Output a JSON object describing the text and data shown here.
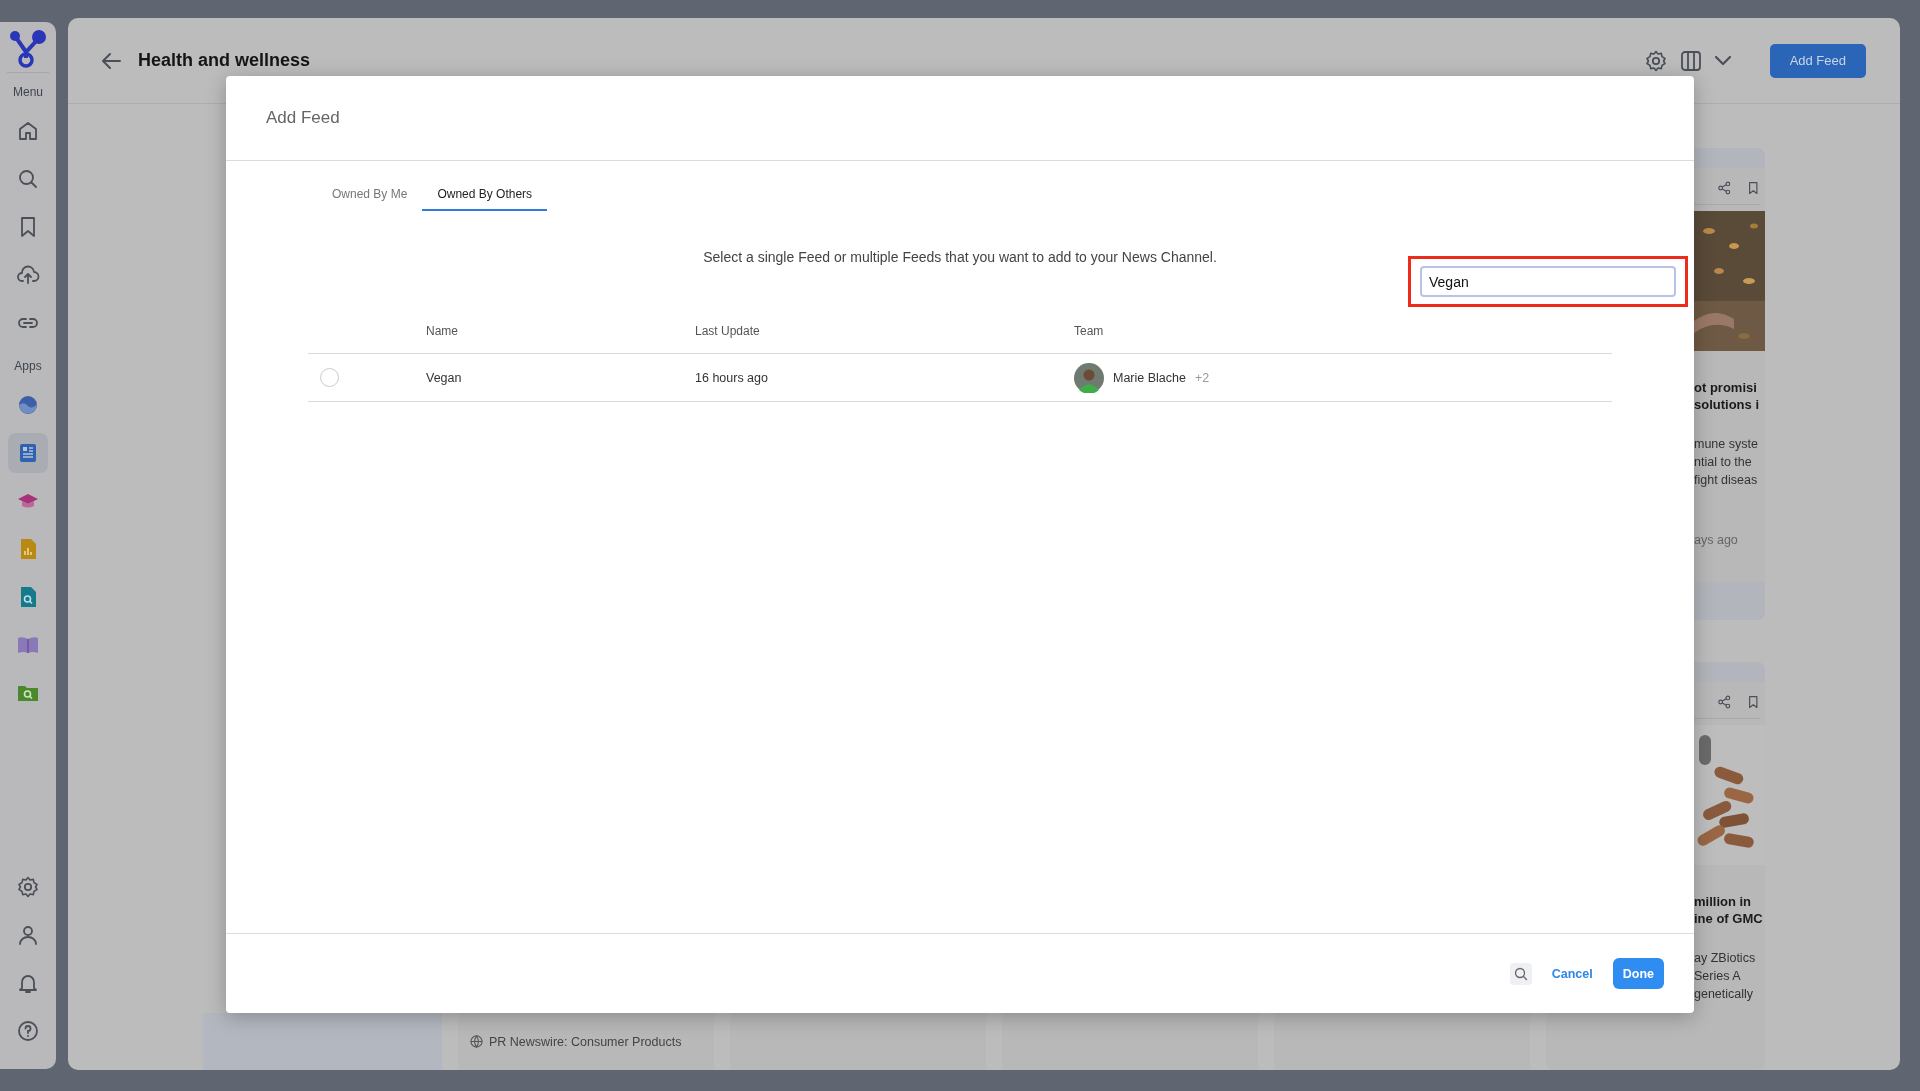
{
  "sidebar": {
    "menu_label": "Menu",
    "menu_items": [
      {
        "kind": "home"
      },
      {
        "kind": "search"
      },
      {
        "kind": "bookmark"
      },
      {
        "kind": "upload"
      },
      {
        "kind": "link"
      }
    ],
    "apps_label": "Apps",
    "apps": [
      {
        "kind": "wave",
        "selected": false
      },
      {
        "kind": "news",
        "selected": true
      },
      {
        "kind": "cap",
        "selected": false
      },
      {
        "kind": "chart",
        "selected": false
      },
      {
        "kind": "docsearch",
        "selected": false
      },
      {
        "kind": "book",
        "selected": false
      },
      {
        "kind": "folder",
        "selected": false
      }
    ],
    "bottom_items": [
      {
        "kind": "settings"
      },
      {
        "kind": "user"
      },
      {
        "kind": "bell"
      },
      {
        "kind": "help"
      }
    ]
  },
  "header": {
    "title": "Health and wellness",
    "add_button": "Add Feed"
  },
  "background_cards": [
    {
      "kind": "leaves",
      "headline": [
        "ot promisi",
        "solutions i"
      ],
      "body": [
        "mune syste",
        "ntial to the",
        "fight diseas"
      ],
      "time": "ays ago"
    },
    {
      "kind": "pills",
      "headline": [
        "million in",
        "ine of GMC"
      ],
      "body": [
        "ay ZBiotics",
        "Series A",
        "genetically"
      ]
    }
  ],
  "bottom_source": "PR Newswire: Consumer Products",
  "dialog": {
    "title": "Add Feed",
    "tabs": [
      {
        "label": "Owned By Me",
        "selected": false
      },
      {
        "label": "Owned By Others",
        "selected": true
      }
    ],
    "instruction": "Select a single Feed or multiple Feeds that you want to add to your News Channel.",
    "search": {
      "value": "Vegan",
      "highlighted": true
    },
    "table": {
      "columns": [
        "Name",
        "Last Update",
        "Team"
      ],
      "rows": [
        {
          "selected": false,
          "name": "Vegan",
          "last_update": "16 hours ago",
          "team_lead": "Marie Blache",
          "team_extra": "+2"
        }
      ]
    },
    "footer": {
      "cancel": "Cancel",
      "done": "Done"
    }
  }
}
